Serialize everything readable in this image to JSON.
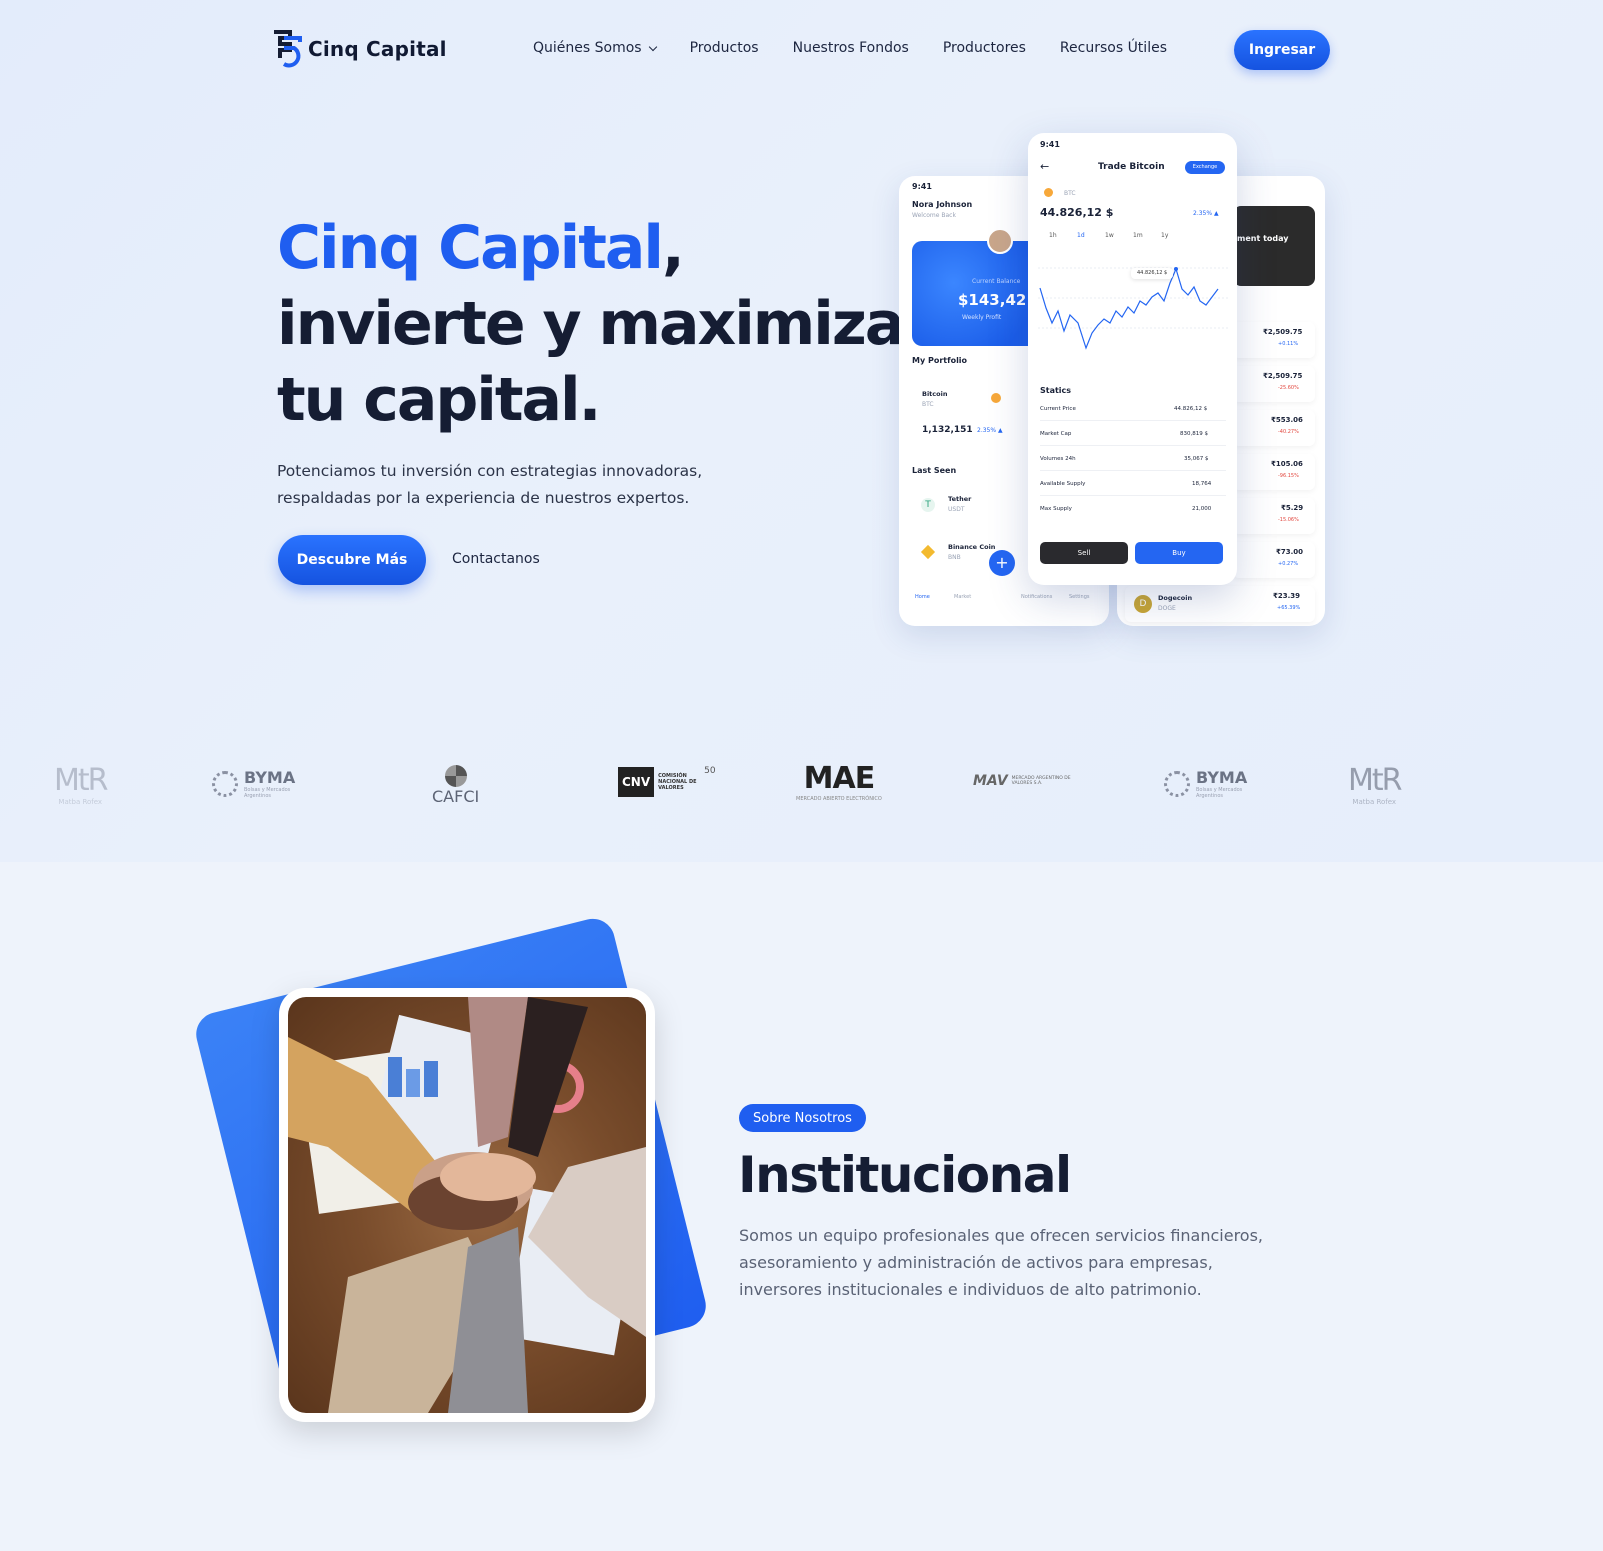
{
  "header": {
    "logo_text": "Cinq Capital",
    "nav": [
      "Quiénes Somos",
      "Productos",
      "Nuestros Fondos",
      "Productores",
      "Recursos Útiles"
    ],
    "login_label": "Ingresar"
  },
  "hero": {
    "title_brand": "Cinq Capital",
    "title_comma": ",",
    "title_line2": "invierte y maximiza",
    "title_line3": "tu capital.",
    "subtitle": "Potenciamos tu inversión con estrategias innovadoras, respaldadas por la experiencia de nuestros expertos.",
    "cta_primary": "Descubre Más",
    "cta_secondary": "Contactanos"
  },
  "phones": {
    "left": {
      "time": "9:41",
      "name": "Nora Johnson",
      "welcome": "Welcome Back",
      "balance_label": "Current Balance",
      "balance": "$143,421",
      "weekly": "Weekly Profit",
      "portfolio": "My Portfolio",
      "coin": "Bitcoin",
      "coin_ticker": "BTC",
      "coin_value": "1,132,151",
      "coin_change": "2.35% ▲",
      "last_seen": "Last Seen",
      "tether": "Tether",
      "tether_ticker": "USDT",
      "binance": "Binance Coin",
      "binance_ticker": "BNB",
      "tabs": [
        "Home",
        "Market",
        "Notifications",
        "Settings"
      ]
    },
    "mid": {
      "time": "9:41",
      "title": "Trade Bitcoin",
      "exchange": "Exchange",
      "ticker": "BTC",
      "price": "44.826,12 $",
      "change": "2.35% ▲",
      "ranges": [
        "1h",
        "1d",
        "1w",
        "1m",
        "1y"
      ],
      "tooltip": "44.826,12 $",
      "stats_title": "Statics",
      "stats": [
        {
          "label": "Current Price",
          "value": "44.826,12 $"
        },
        {
          "label": "Market Cap",
          "value": "830,819 $"
        },
        {
          "label": "Volumes 24h",
          "value": "35,067 $"
        },
        {
          "label": "Available Supply",
          "value": "18,764"
        },
        {
          "label": "Max Supply",
          "value": "21,000"
        }
      ],
      "sell": "Sell",
      "buy": "Buy"
    },
    "right": {
      "card_text": "ment today",
      "prices": [
        {
          "value": "₹2,509.75",
          "change": "+0.11%",
          "color": "#2466f2"
        },
        {
          "value": "₹2,509.75",
          "change": "-25.60%",
          "color": "#e2473f"
        },
        {
          "value": "₹553.06",
          "change": "-40.27%",
          "color": "#e2473f"
        },
        {
          "value": "₹105.06",
          "change": "-96.15%",
          "color": "#e2473f"
        },
        {
          "value": "₹5.29",
          "change": "-15.06%",
          "color": "#e2473f"
        },
        {
          "value": "₹73.00",
          "change": "+0.27%",
          "color": "#2466f2"
        },
        {
          "value": "₹23.39",
          "change": "+65.39%",
          "color": "#2466f2"
        }
      ],
      "doge": "Dogecoin",
      "doge_sub": "DOGE"
    }
  },
  "partners": [
    {
      "name": "MtR",
      "sub": "Matba Rofex"
    },
    {
      "name": "BYMA",
      "sub": "Bolsas y Mercados Argentinos"
    },
    {
      "name": "CAFCI",
      "sub": ""
    },
    {
      "name": "CNV",
      "sub": "COMISIÓN NACIONAL DE VALORES"
    },
    {
      "name": "MAE",
      "sub": "MERCADO ABIERTO ELECTRÓNICO"
    },
    {
      "name": "MAV",
      "sub": "MERCADO ARGENTINO DE VALORES S.A."
    },
    {
      "name": "BYMA",
      "sub": "Bolsas y Mercados Argentinos"
    },
    {
      "name": "MtR",
      "sub": "Matba Rofex"
    }
  ],
  "cnv_badge": "50",
  "about": {
    "badge": "Sobre Nosotros",
    "title": "Institucional",
    "text": "Somos un equipo profesionales que ofrecen servicios financieros, asesoramiento y administración de activos para empresas, inversores institucionales e individuos de alto patrimonio."
  },
  "colors": {
    "accent": "#1f5ef0",
    "heading": "#151d33"
  }
}
